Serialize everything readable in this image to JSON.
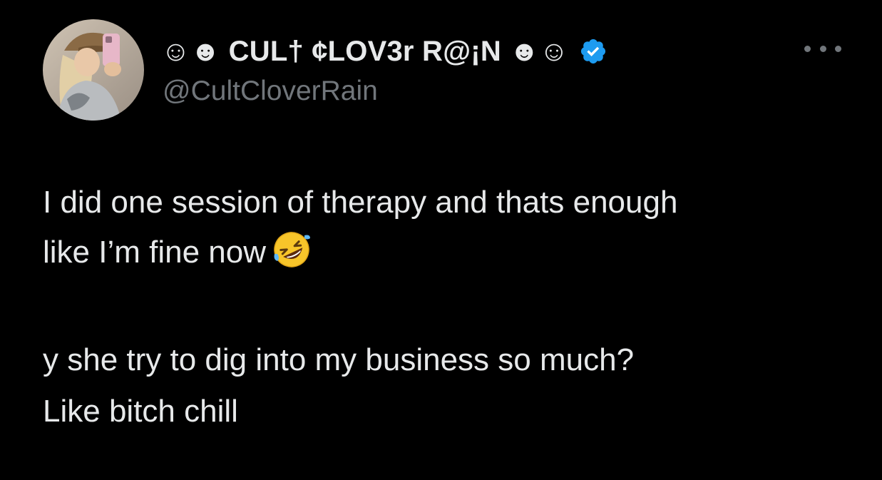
{
  "author": {
    "display_name": "☺☻ CUL† ¢LOV3r R@¡N ☻☺",
    "handle": "@CultCloverRain",
    "verified": true,
    "avatar_icon": "profile-photo-avatar"
  },
  "menu": {
    "icon": "more-horizontal-icon"
  },
  "tweet": {
    "line_1": "I did one session of therapy and thats enough",
    "line_2": "like I’m fine now",
    "line_2_emoji": "rolling-on-floor-laughing-emoji",
    "line_3": "y she try to dig into my business so much?",
    "line_4": "Like bitch chill"
  },
  "colors": {
    "background": "#000000",
    "primary_text": "#e7e9ea",
    "secondary_text": "#71767b",
    "verified_blue": "#1d9bf0"
  }
}
